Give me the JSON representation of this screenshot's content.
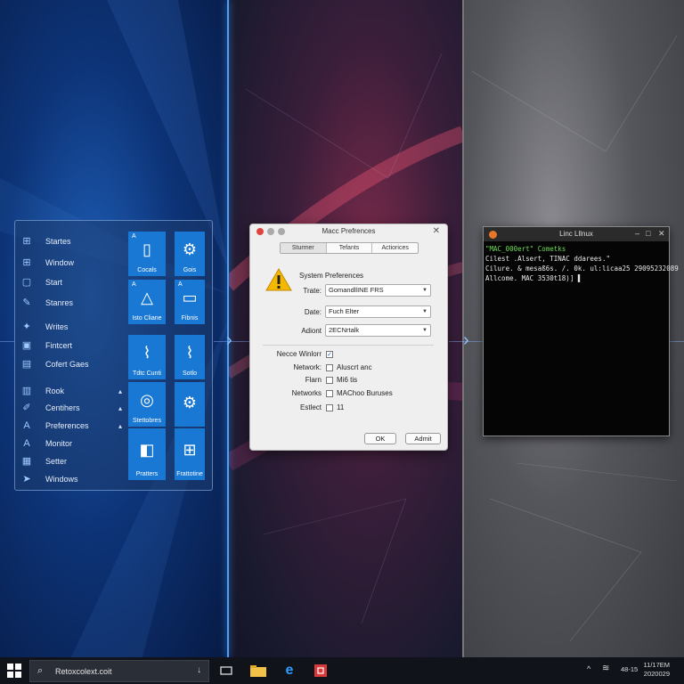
{
  "start_menu": {
    "items": [
      {
        "icon": "grid-icon",
        "label": "Startes"
      },
      {
        "icon": "grid-icon",
        "label": "Window"
      },
      {
        "icon": "square-icon",
        "label": "Start"
      },
      {
        "icon": "pen-icon",
        "label": "Stanres"
      },
      {
        "icon": "puzzle-icon",
        "label": "Writes"
      },
      {
        "icon": "image-icon",
        "label": "Fintcert"
      },
      {
        "icon": "map-icon",
        "label": "Cofert Gaes"
      },
      {
        "icon": "book-icon",
        "label": "Rook"
      },
      {
        "icon": "brush-icon",
        "label": "Centihers"
      },
      {
        "icon": "a-icon",
        "label": "Preferences"
      },
      {
        "icon": "a-icon",
        "label": "Monitor"
      },
      {
        "icon": "table-icon",
        "label": "Setter"
      },
      {
        "icon": "arrow-icon",
        "label": "Windows"
      }
    ],
    "tiles": [
      {
        "label": "Cocals",
        "icon": "device-icon",
        "corner": "A"
      },
      {
        "label": "Gois",
        "icon": "gear-icon",
        "corner": ""
      },
      {
        "label": "Isto Cliane",
        "icon": "cloud-icon",
        "corner": "A"
      },
      {
        "label": "Fibnis",
        "icon": "monitor-icon",
        "corner": "A"
      },
      {
        "label": "Tdtc Cunti",
        "icon": "chart-icon",
        "corner": ""
      },
      {
        "label": "Sotlo",
        "icon": "chart2-icon",
        "corner": ""
      },
      {
        "label": "Stettobres",
        "icon": "camera-icon",
        "corner": ""
      },
      {
        "label": "",
        "icon": "gear-icon",
        "corner": ""
      },
      {
        "label": "Pratters",
        "icon": "store-icon",
        "corner": ""
      },
      {
        "label": "Frattotine",
        "icon": "windows-icon",
        "corner": ""
      }
    ]
  },
  "mac_dialog": {
    "title": "Macc Prefrences",
    "tabs": [
      "Sturmer",
      "Tefants",
      "Actiorices"
    ],
    "heading": "System Preferences",
    "fields": [
      {
        "label": "Trate:",
        "value": "GomandllINE FRS"
      },
      {
        "label": "Date:",
        "value": "Fuch Elter"
      },
      {
        "label": "Adiont",
        "value": "2ECNrtalk"
      }
    ],
    "checks": [
      {
        "label": "Necce Winlorr",
        "text": "",
        "checked": true
      },
      {
        "label": "Network:",
        "text": "Aluscrt anc",
        "checked": false
      },
      {
        "label": "Flarn",
        "text": "Mi6 tis",
        "checked": false
      },
      {
        "label": "Networks",
        "text": "MAChoo Buruses",
        "checked": false
      },
      {
        "label": "Estlect",
        "text": "11",
        "checked": false
      }
    ],
    "ok_label": "OK",
    "admit_label": "Admit"
  },
  "terminal": {
    "title": "Linc Lllnux",
    "lines": [
      {
        "text": "\"MAC_000ert\" Cometks",
        "color": "#6fdc5a"
      },
      {
        "text": "Cilest .Alsert, TINAC ddarees.\"",
        "color": "#e8e8e8"
      },
      {
        "text": "Cilure. & mesaß6s. /. 0k. ul:licaa25 29095232089",
        "color": "#e8e8e8"
      },
      {
        "text": "Allcome. MAC 3530t18)] ▌",
        "color": "#e8e8e8"
      }
    ]
  },
  "taskbar": {
    "search_text": "Retoxcolext.coit",
    "time": "11/17EM",
    "date": "2020029",
    "tray_text": "48-15"
  },
  "colors": {
    "accent_blue": "#1978d4",
    "terminal_green": "#6fdc5a",
    "close_red": "#e0443e"
  }
}
